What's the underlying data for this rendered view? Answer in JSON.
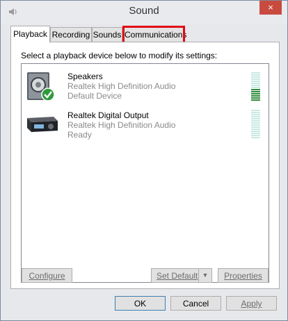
{
  "window": {
    "title": "Sound",
    "close_label": "×"
  },
  "tabs": [
    {
      "label": "Playback",
      "active": true
    },
    {
      "label": "Recording",
      "active": false
    },
    {
      "label": "Sounds",
      "active": false
    },
    {
      "label": "Communications",
      "active": false,
      "highlighted": true
    }
  ],
  "panel": {
    "instruction": "Select a playback device below to modify its settings:",
    "devices": [
      {
        "name": "Speakers",
        "driver": "Realtek High Definition Audio",
        "status": "Default Device",
        "icon": "speaker-default-icon",
        "meter_active_segments": 6
      },
      {
        "name": "Realtek Digital Output",
        "driver": "Realtek High Definition Audio",
        "status": "Ready",
        "icon": "digital-output-icon",
        "meter_active_segments": 0
      }
    ],
    "buttons": {
      "configure": "Configure",
      "set_default": "Set Default",
      "properties": "Properties"
    }
  },
  "footer": {
    "ok": "OK",
    "cancel": "Cancel",
    "apply": "Apply"
  },
  "colors": {
    "highlight_box": "#e30613",
    "meter_active": "#2e8b3a",
    "meter_inactive": "#c9e8e3",
    "close_button": "#c94b3f"
  }
}
